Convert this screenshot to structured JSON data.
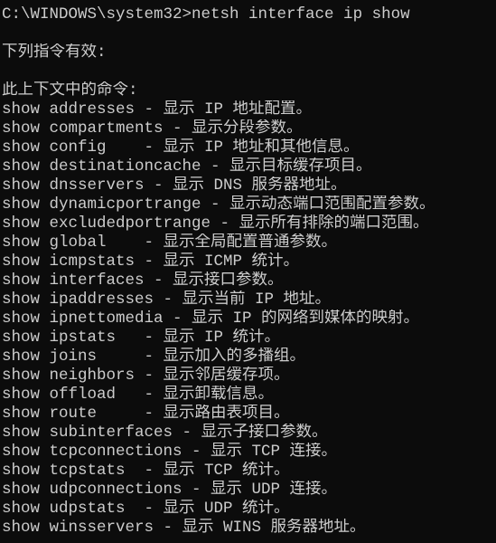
{
  "console": {
    "prompt_line": "C:\\WINDOWS\\system32>netsh interface ip show",
    "valid_commands_heading": "下列指令有效:",
    "context_commands_heading": "此上下文中的命令:",
    "commands": [
      "show addresses - 显示 IP 地址配置。",
      "show compartments - 显示分段参数。",
      "show config    - 显示 IP 地址和其他信息。",
      "show destinationcache - 显示目标缓存项目。",
      "show dnsservers - 显示 DNS 服务器地址。",
      "show dynamicportrange - 显示动态端口范围配置参数。",
      "show excludedportrange - 显示所有排除的端口范围。",
      "show global    - 显示全局配置普通参数。",
      "show icmpstats - 显示 ICMP 统计。",
      "show interfaces - 显示接口参数。",
      "show ipaddresses - 显示当前 IP 地址。",
      "show ipnettomedia - 显示 IP 的网络到媒体的映射。",
      "show ipstats   - 显示 IP 统计。",
      "show joins     - 显示加入的多播组。",
      "show neighbors - 显示邻居缓存项。",
      "show offload   - 显示卸载信息。",
      "show route     - 显示路由表项目。",
      "show subinterfaces - 显示子接口参数。",
      "show tcpconnections - 显示 TCP 连接。",
      "show tcpstats  - 显示 TCP 统计。",
      "show udpconnections - 显示 UDP 连接。",
      "show udpstats  - 显示 UDP 统计。",
      "show winsservers - 显示 WINS 服务器地址。"
    ]
  }
}
